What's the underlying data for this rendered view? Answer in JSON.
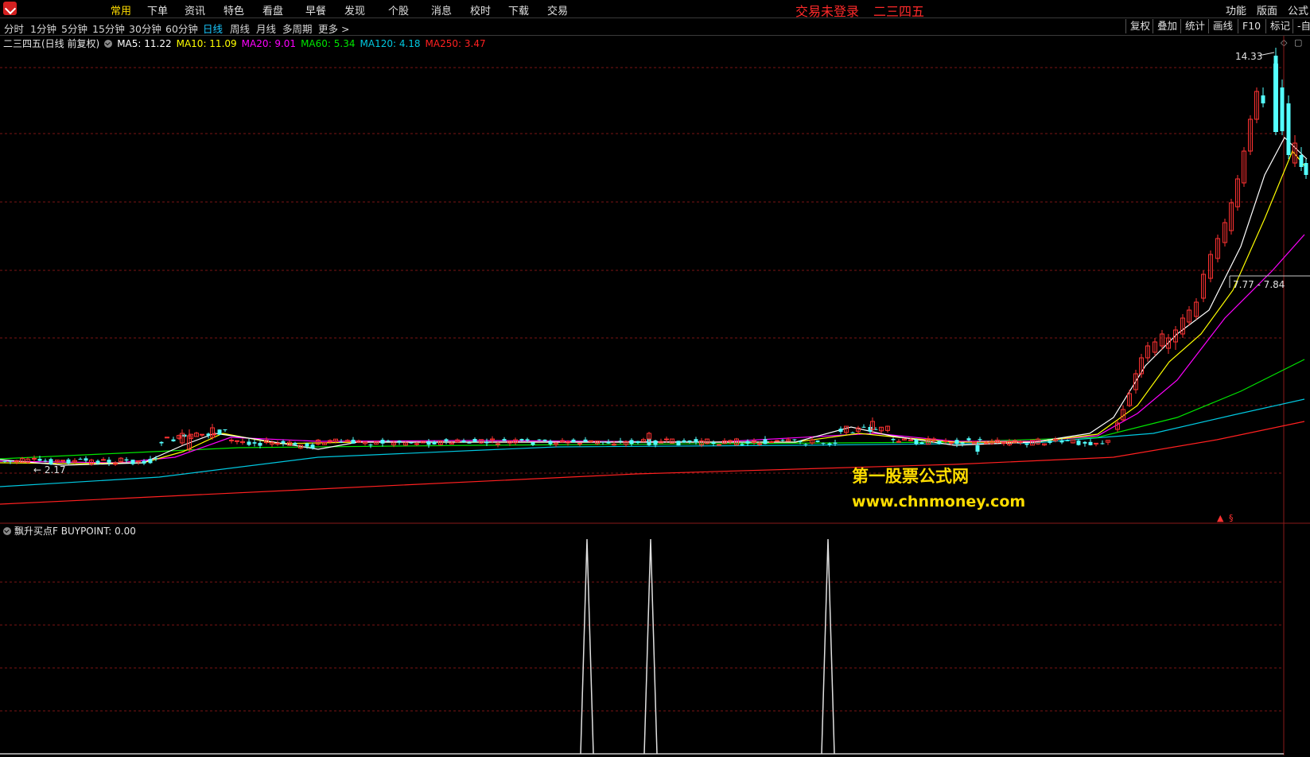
{
  "menu": {
    "items": [
      "常用",
      "下单",
      "资讯",
      "特色",
      "看盘",
      "早餐",
      "发现",
      "个股",
      "消息",
      "校时",
      "下载",
      "交易"
    ],
    "active": 0,
    "banner": [
      "交易未登录",
      "二三四五"
    ],
    "right": [
      "功能",
      "版面",
      "公式"
    ]
  },
  "toolbar": {
    "periods": [
      "分时",
      "1分钟",
      "5分钟",
      "15分钟",
      "30分钟",
      "60分钟",
      "日线",
      "周线",
      "月线",
      "多周期",
      "更多 >"
    ],
    "active_period": 6,
    "buttons": [
      "复权",
      "叠加",
      "统计",
      "画线",
      "F10",
      "标记",
      "-自选"
    ]
  },
  "main": {
    "title": "二三四五(日线 前复权)",
    "ma": [
      {
        "label": "MA5: 11.22",
        "color": "#ffffff"
      },
      {
        "label": "MA10: 11.09",
        "color": "#ffff00"
      },
      {
        "label": "MA20: 9.01",
        "color": "#ff00ff"
      },
      {
        "label": "MA60: 5.34",
        "color": "#00e600"
      },
      {
        "label": "MA120: 4.18",
        "color": "#00c8e0"
      },
      {
        "label": "MA250: 3.47",
        "color": "#ff2020"
      }
    ],
    "high_label": "14.33",
    "low_label": "2.17",
    "range_label": "7.77 - 7.84",
    "watermark_name": "第一股票公式网",
    "watermark_url": "www.chnmoney.com"
  },
  "sub": {
    "title": "飘升买点F BUYPOINT: 0.00"
  },
  "colors": {
    "up": "#ff3232",
    "down": "#54ffff",
    "grid": "#7a1515"
  }
}
